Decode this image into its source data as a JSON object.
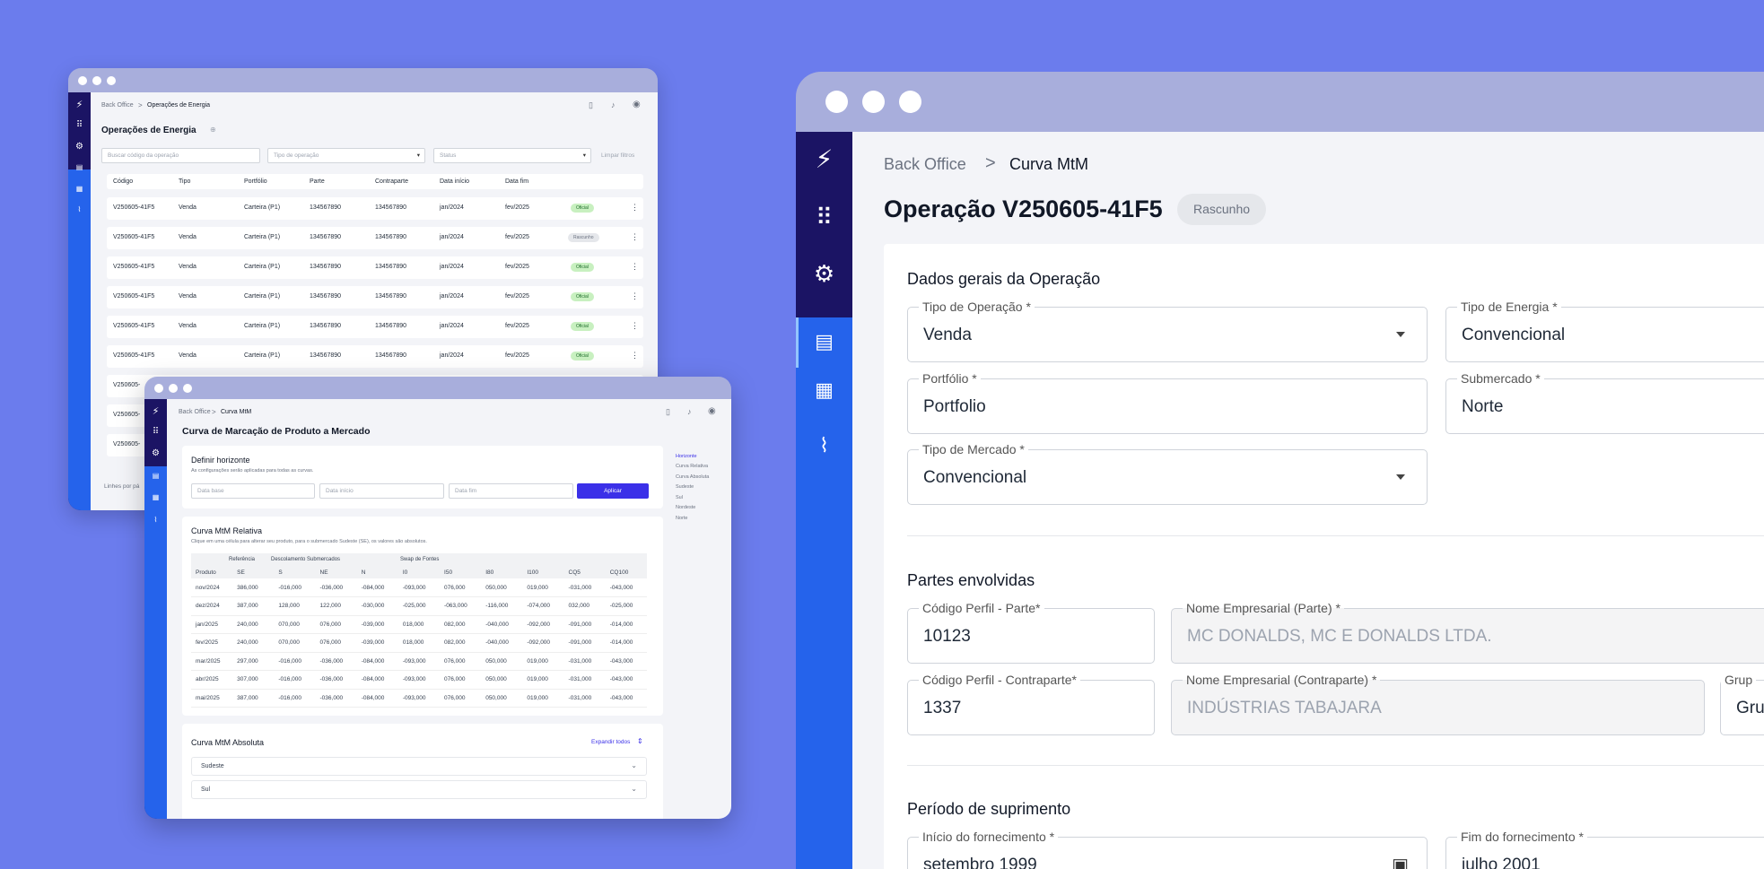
{
  "ops_window": {
    "breadcrumb_root": "Back Office",
    "breadcrumb_sep": ">",
    "breadcrumb_current": "Operações de Energia",
    "title": "Operações de Energia",
    "search_placeholder": "Buscar código da operação",
    "type_select": "Tipo de operação",
    "status_select": "Status",
    "clear_filters": "Limpar filtros",
    "columns": [
      "Código",
      "Tipo",
      "Portfólio",
      "Parte",
      "Contraparte",
      "Data início",
      "Data fim"
    ],
    "rows": [
      {
        "code": "V250605-41F5",
        "type": "Venda",
        "portfolio": "Carteira (P1)",
        "party": "134567890",
        "counterparty": "134567890",
        "start": "jan/2024",
        "end": "fev/2025",
        "status": "Oficial"
      },
      {
        "code": "V250605-41F5",
        "type": "Venda",
        "portfolio": "Carteira (P1)",
        "party": "134567890",
        "counterparty": "134567890",
        "start": "jan/2024",
        "end": "fev/2025",
        "status": "Rascunho"
      },
      {
        "code": "V250605-41F5",
        "type": "Venda",
        "portfolio": "Carteira (P1)",
        "party": "134567890",
        "counterparty": "134567890",
        "start": "jan/2024",
        "end": "fev/2025",
        "status": "Oficial"
      },
      {
        "code": "V250605-41F5",
        "type": "Venda",
        "portfolio": "Carteira (P1)",
        "party": "134567890",
        "counterparty": "134567890",
        "start": "jan/2024",
        "end": "fev/2025",
        "status": "Oficial"
      },
      {
        "code": "V250605-41F5",
        "type": "Venda",
        "portfolio": "Carteira (P1)",
        "party": "134567890",
        "counterparty": "134567890",
        "start": "jan/2024",
        "end": "fev/2025",
        "status": "Oficial"
      },
      {
        "code": "V250605-41F5",
        "type": "Venda",
        "portfolio": "Carteira (P1)",
        "party": "134567890",
        "counterparty": "134567890",
        "start": "jan/2024",
        "end": "fev/2025",
        "status": "Oficial"
      }
    ],
    "partial_code_1": "V250605-",
    "partial_code_2": "V250605-",
    "partial_code_3": "V250605-",
    "footer_partial": "Linhes por pá"
  },
  "mtm_window": {
    "breadcrumb_root": "Back Office",
    "breadcrumb_sep": ">",
    "breadcrumb_current": "Curva MtM",
    "title": "Curva de Marcação de Produto a Mercado",
    "horizon": {
      "title": "Definir horizonte",
      "subtitle": "As configurações serão aplicadas para todas as curvas.",
      "base_placeholder": "Data base",
      "start_placeholder": "Data início",
      "end_placeholder": "Data fim",
      "apply": "Aplicar"
    },
    "relative": {
      "title": "Curva MtM Relativa",
      "subtitle": "Clique em uma célula para alterar seu produto, para o submercado Sudeste (SE), os valores são absolutos.",
      "group_ref": "Referência",
      "group_desc": "Descolamento Submercados",
      "group_swap": "Swap de Fontes",
      "headers": [
        "Produto",
        "SE",
        "S",
        "NE",
        "N",
        "I0",
        "I50",
        "I80",
        "I100",
        "CQ5",
        "CQ100"
      ],
      "rows": [
        [
          "nov/2024",
          "386,000",
          "-016,000",
          "-036,000",
          "-084,000",
          "-093,000",
          "076,000",
          "050,000",
          "019,000",
          "-031,000",
          "-043,000"
        ],
        [
          "dez/2024",
          "387,000",
          "128,000",
          "122,000",
          "-030,000",
          "-025,000",
          "-063,000",
          "-116,000",
          "-074,000",
          "032,000",
          "-025,000"
        ],
        [
          "jan/2025",
          "240,000",
          "070,000",
          "076,000",
          "-039,000",
          "018,000",
          "082,000",
          "-040,000",
          "-092,000",
          "-091,000",
          "-014,000"
        ],
        [
          "fev/2025",
          "240,000",
          "070,000",
          "076,000",
          "-039,000",
          "018,000",
          "082,000",
          "-040,000",
          "-092,000",
          "-091,000",
          "-014,000"
        ],
        [
          "mar/2025",
          "297,000",
          "-016,000",
          "-036,000",
          "-084,000",
          "-093,000",
          "076,000",
          "050,000",
          "019,000",
          "-031,000",
          "-043,000"
        ],
        [
          "abr/2025",
          "307,000",
          "-016,000",
          "-036,000",
          "-084,000",
          "-093,000",
          "076,000",
          "050,000",
          "019,000",
          "-031,000",
          "-043,000"
        ],
        [
          "mai/2025",
          "387,000",
          "-016,000",
          "-036,000",
          "-084,000",
          "-093,000",
          "076,000",
          "050,000",
          "019,000",
          "-031,000",
          "-043,000"
        ]
      ]
    },
    "absolute": {
      "title": "Curva MtM Absoluta",
      "expand": "Expandir todos",
      "items": [
        "Sudeste",
        "Sul"
      ]
    },
    "toc": [
      "Horizonte",
      "Curva Relativa",
      "Curva Absoluta",
      "Sudeste",
      "Sul",
      "Nordeste",
      "Norte"
    ]
  },
  "op_window": {
    "breadcrumb_root": "Back Office",
    "breadcrumb_sep": ">",
    "breadcrumb_current": "Curva MtM",
    "title": "Operação V250605-41F5",
    "status_chip": "Rascunho",
    "general": {
      "title": "Dados gerais da Operação",
      "op_type_label": "Tipo de Operação *",
      "op_type_value": "Venda",
      "energy_type_label": "Tipo de Energia *",
      "energy_type_value": "Convencional",
      "portfolio_label": "Portfólio *",
      "portfolio_value": "Portfolio",
      "submarket_label": "Submercado *",
      "submarket_value": "Norte",
      "market_type_label": "Tipo de Mercado *",
      "market_type_value": "Convencional"
    },
    "parties": {
      "title": "Partes envolvidas",
      "party_code_label": "Código Perfil - Parte*",
      "party_code_value": "10123",
      "party_name_label": "Nome Empresarial (Parte) *",
      "party_name_value": "MC DONALDS, MC E DONALDS LTDA.",
      "cparty_code_label": "Código Perfil - Contraparte*",
      "cparty_code_value": "1337",
      "cparty_name_label": "Nome Empresarial (Contraparte) *",
      "cparty_name_value": "INDÚSTRIAS TABAJARA",
      "group_label": "Grup",
      "group_value": "Gru"
    },
    "supply": {
      "title": "Período de suprimento",
      "start_label": "Início do fornecimento *",
      "start_value": "setembro 1999",
      "end_label": "Fim do fornecimento *",
      "end_value": "julho 2001"
    }
  }
}
